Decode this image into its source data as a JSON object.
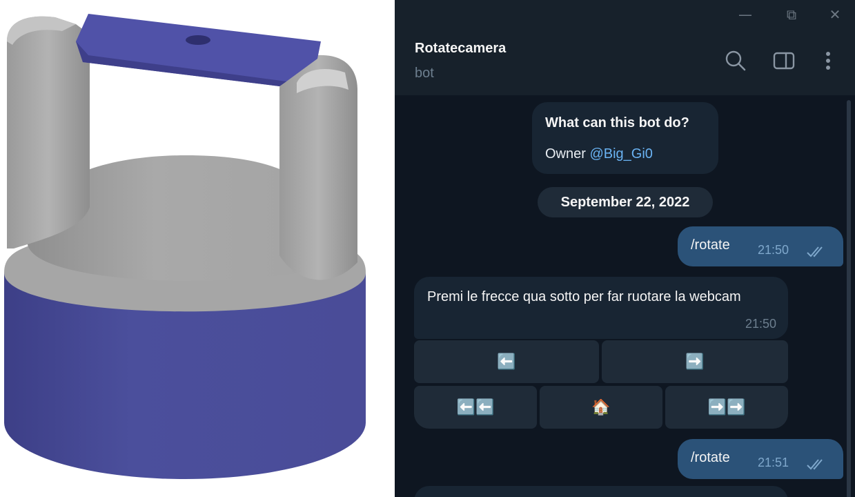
{
  "window": {
    "controls": {
      "minimize": "—",
      "restore": "⧉",
      "close": "✕"
    }
  },
  "header": {
    "title": "Rotatecamera",
    "subtitle": "bot",
    "icons": [
      "search-icon",
      "sidebar-toggle-icon",
      "more-vertical-icon"
    ]
  },
  "bot_info": {
    "title": "What can this bot do?",
    "owner_prefix": "Owner ",
    "owner_link": "@Big_Gi0"
  },
  "date_separator": "September 22, 2022",
  "messages": [
    {
      "direction": "out",
      "text": "/rotate",
      "time": "21:50",
      "status": "read"
    },
    {
      "direction": "in",
      "text": "Premi le frecce qua sotto per far ruotare la webcam",
      "time": "21:50"
    },
    {
      "direction": "out",
      "text": "/rotate",
      "time": "21:51",
      "status": "read"
    }
  ],
  "inline_keyboard": {
    "row1": [
      "⬅️",
      "➡️"
    ],
    "row2": [
      "⬅️⬅️",
      "🏠",
      "➡️➡️"
    ]
  },
  "colors": {
    "chat_bg": "#0e1621",
    "header_bg": "#17212b",
    "incoming_bubble": "#182533",
    "outgoing_bubble": "#2b5278",
    "link": "#6ab3f3",
    "model_blue": "#4b4f9c",
    "model_grey": "#a8a8a8"
  }
}
